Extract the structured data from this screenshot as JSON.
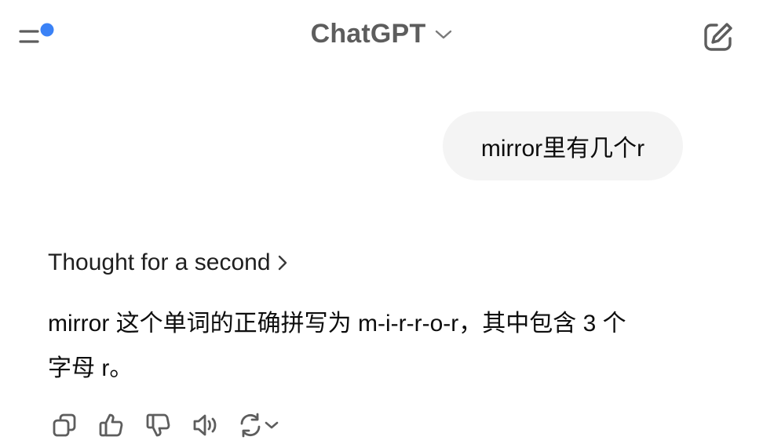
{
  "header": {
    "title": "ChatGPT",
    "notification_dot_color": "#3b82f6",
    "icons": {
      "menu": "sidebar-menu-icon",
      "model_switch": "chevron-down-icon",
      "new_chat": "edit-pen-icon"
    }
  },
  "conversation": {
    "user_message": "mirror里有几个r",
    "assistant": {
      "thought_label": "Thought for a second",
      "answer_line1": "mirror 这个单词的正确拼写为 m-i-r-r-o-r，其中包含 3 个",
      "answer_line2": "字母 r。"
    }
  },
  "actions": {
    "icons": [
      "copy-icon",
      "thumbs-up-icon",
      "thumbs-down-icon",
      "read-aloud-icon",
      "regenerate-icon",
      "chevron-down-icon"
    ]
  },
  "colors": {
    "title": "#5d5d5d",
    "icon": "#5d5d5d",
    "bubble_bg": "#f4f4f4",
    "text": "#0d0d0d"
  }
}
